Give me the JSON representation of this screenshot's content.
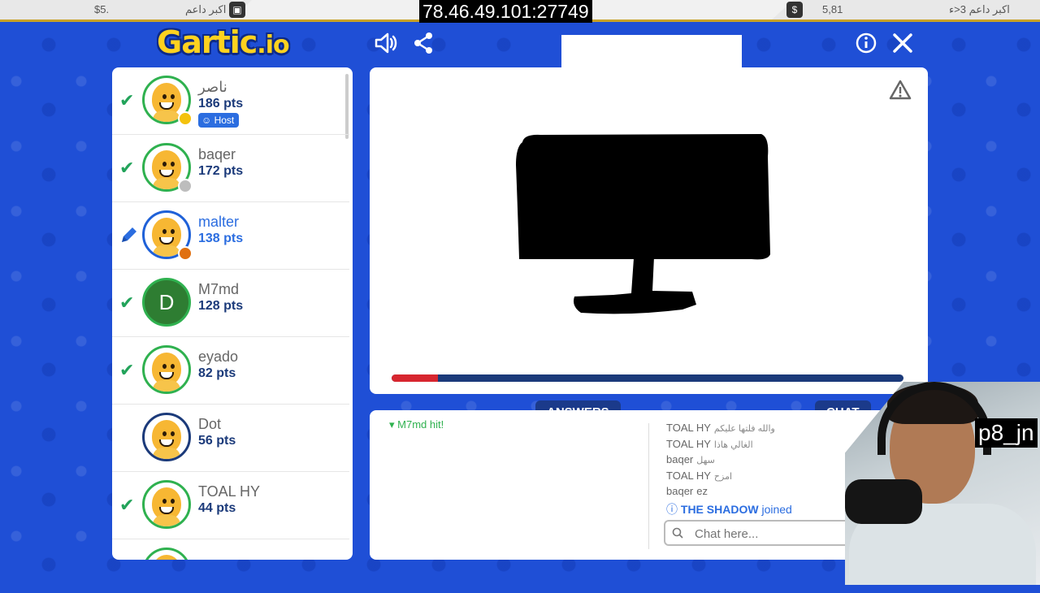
{
  "os_bar": {
    "left_price": "$5.",
    "left_label": "اكبر داعم",
    "right_value": "5,81",
    "right_label": "اكبر داعم 3<ء"
  },
  "overlay": {
    "ip": "78.46.49.101:27749",
    "handle": "p8_jn"
  },
  "header": {
    "logo_main": "Gartic",
    "logo_suffix": ".io",
    "icons": [
      "sound-icon",
      "share-icon",
      "info-icon",
      "close-icon"
    ]
  },
  "players": [
    {
      "name": "ناصر",
      "pts": "186 pts",
      "status": "check",
      "avatar": "default",
      "dot_color": "#f4c20d",
      "badge": "Host",
      "active": false
    },
    {
      "name": "baqer",
      "pts": "172 pts",
      "status": "check",
      "avatar": "default",
      "dot_color": "#bdbdbd",
      "badge": "",
      "active": false
    },
    {
      "name": "malter",
      "pts": "138 pts",
      "status": "pencil",
      "avatar": "default",
      "dot_color": "#e07010",
      "badge": "",
      "active": true
    },
    {
      "name": "M7md",
      "pts": "128 pts",
      "status": "check",
      "avatar": "letter",
      "letter": "D",
      "dot_color": "",
      "badge": "",
      "active": false
    },
    {
      "name": "eyado",
      "pts": "82 pts",
      "status": "check",
      "avatar": "default",
      "dot_color": "",
      "badge": "",
      "active": false
    },
    {
      "name": "Dot",
      "pts": "56 pts",
      "status": "none",
      "avatar": "default",
      "dot_color": "",
      "badge": "",
      "active": false
    },
    {
      "name": "TOAL HY",
      "pts": "44 pts",
      "status": "check",
      "avatar": "default",
      "dot_color": "",
      "badge": "",
      "active": false
    }
  ],
  "canvas": {
    "timer_progress": 0.09,
    "timer_fill_color": "#d7262f",
    "timer_track_color": "#1b3a7a"
  },
  "tabs": {
    "answers": "ANSWERS",
    "chat": "CHAT"
  },
  "answers": {
    "partial_line": "M7md hit!"
  },
  "chat": {
    "messages": [
      {
        "user": "TOAL HY",
        "text": "والله فلتها عليكم"
      },
      {
        "user": "TOAL HY",
        "text": "الغالي هاذا"
      },
      {
        "user": "baqer",
        "text": "سهل"
      },
      {
        "user": "TOAL HY",
        "text": "امزح"
      },
      {
        "user": "baqer",
        "text": "ez"
      }
    ],
    "system_message": {
      "user": "THE SHADOW",
      "text": "joined"
    },
    "input_placeholder": "Chat here..."
  }
}
